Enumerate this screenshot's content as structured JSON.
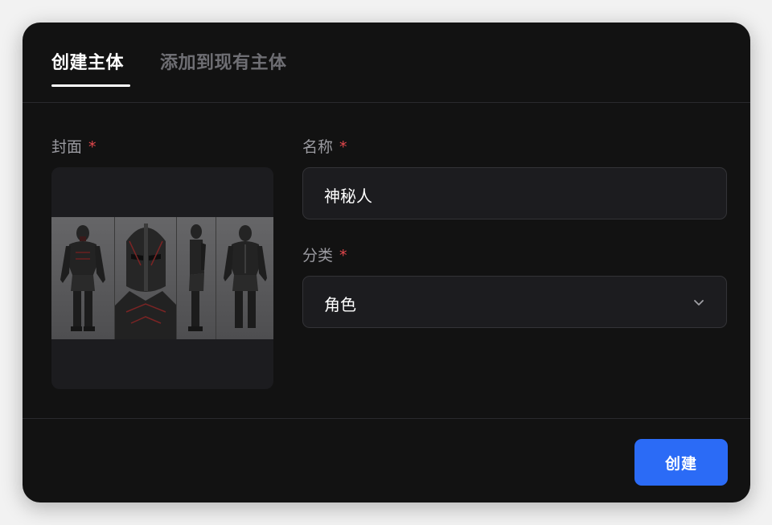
{
  "tabs": [
    {
      "label": "创建主体",
      "active": true
    },
    {
      "label": "添加到现有主体",
      "active": false
    }
  ],
  "form": {
    "cover": {
      "label": "封面",
      "required_mark": "*"
    },
    "name": {
      "label": "名称",
      "required_mark": "*",
      "value": "神秘人"
    },
    "category": {
      "label": "分类",
      "required_mark": "*",
      "value": "角色",
      "icon": "chevron-down-icon"
    }
  },
  "actions": {
    "create_label": "创建"
  },
  "colors": {
    "background": "#121212",
    "accent": "#2b6bf6",
    "required": "#e5484d",
    "input_bg": "#1c1c1f"
  }
}
